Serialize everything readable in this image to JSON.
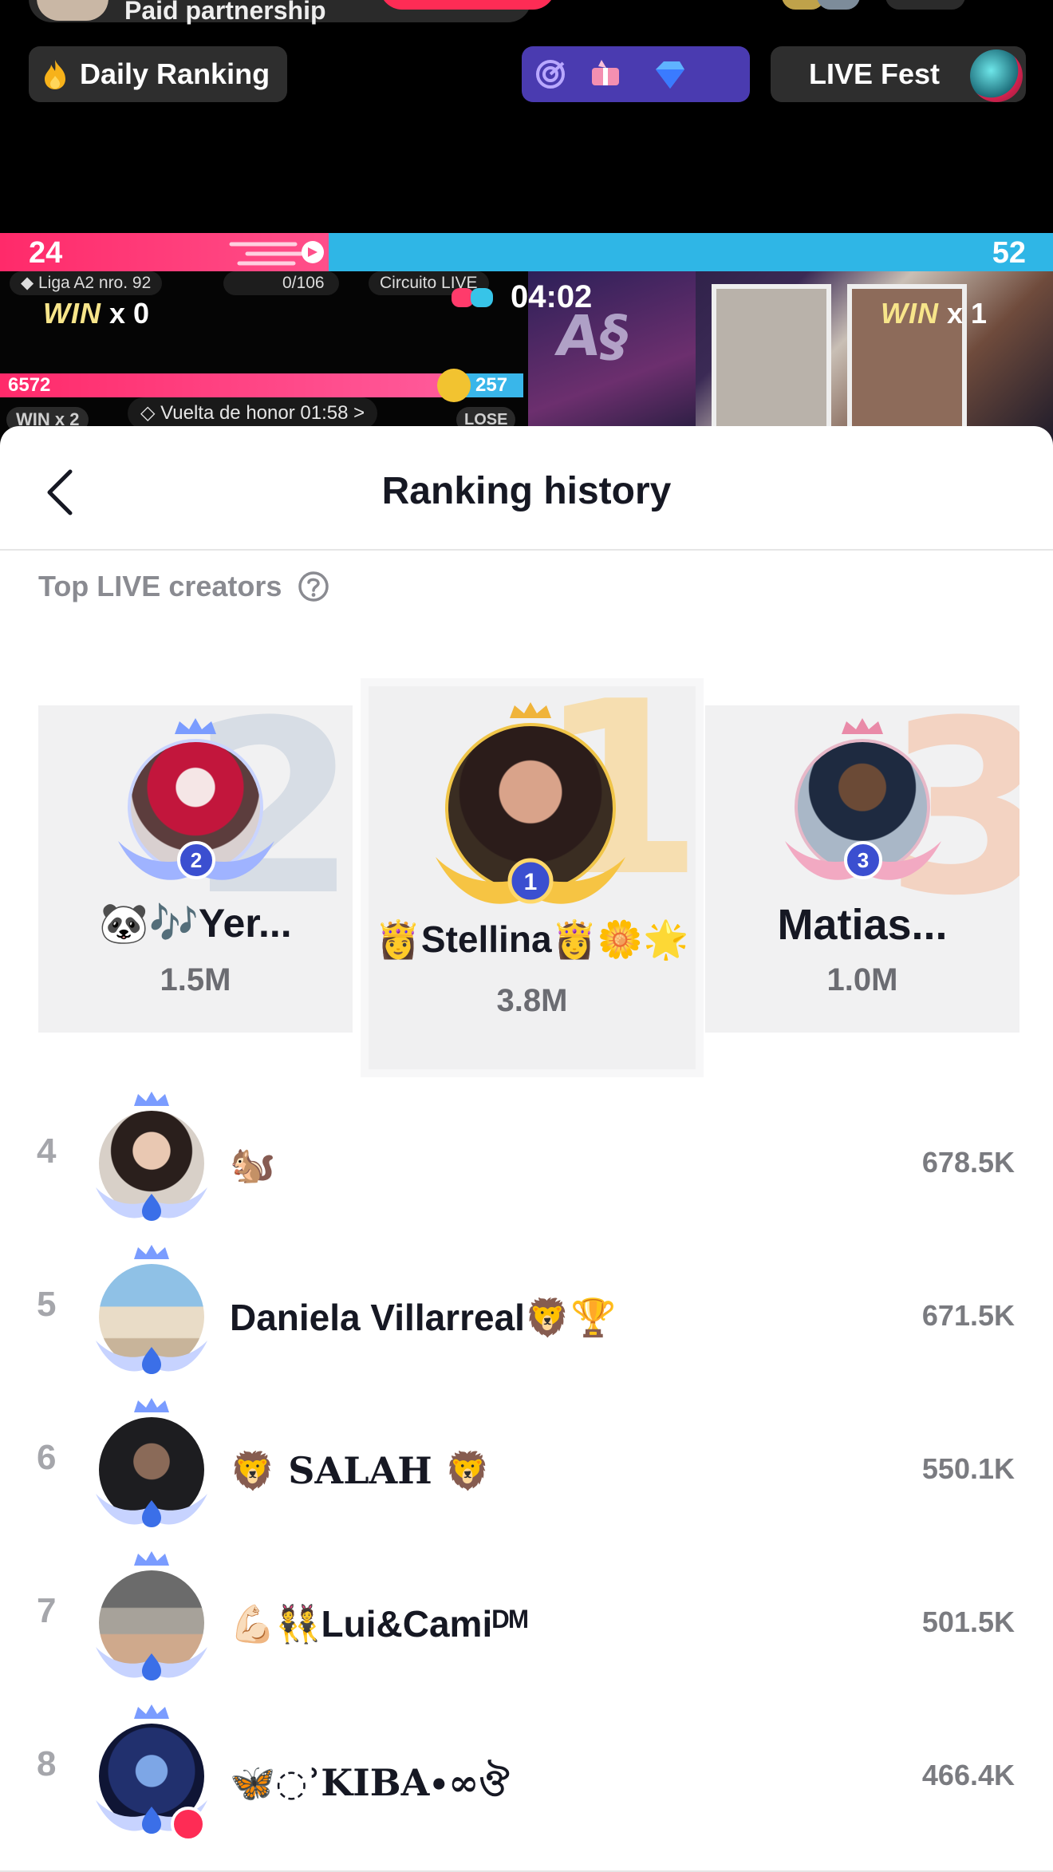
{
  "top": {
    "partnership_label": "Paid partnership",
    "daily_ranking_label": "Daily Ranking",
    "live_fest_label": "LIVE Fest",
    "battle": {
      "score_left": "24",
      "score_right": "52",
      "league_label": "Liga A2 nro. 92",
      "progress_label": "0/106",
      "circuit_label": "Circuito LIVE",
      "timer": "04:02",
      "win_word": "WIN",
      "win_left_count": "x 0",
      "win_right_count": "x 1",
      "sub_left_score": "6572",
      "sub_right_score": "257",
      "winx2_label": "WIN x 2",
      "honor_label": "Vuelta de honor  01:58  >",
      "lose_label": "LOSE"
    }
  },
  "sheet": {
    "title": "Ranking history",
    "section_label": "Top LIVE creators"
  },
  "podium": {
    "first": {
      "rank": "1",
      "name": "👸Stellina👸🌼🌟",
      "score": "3.8M"
    },
    "second": {
      "rank": "2",
      "name": "🐼🎶Yer...",
      "score": "1.5M"
    },
    "third": {
      "rank": "3",
      "name": "Matias...",
      "score": "1.0M"
    }
  },
  "ranking": [
    {
      "rank": "4",
      "name": "🐿️",
      "score": "678.5K"
    },
    {
      "rank": "5",
      "name": "Daniela Villarreal🦁🏆",
      "score": "671.5K"
    },
    {
      "rank": "6",
      "name": "🦁 SALAH 🦁",
      "score": "550.1K"
    },
    {
      "rank": "7",
      "name": "💪🏻👯Lui&Camiᴰᴹ",
      "score": "501.5K"
    },
    {
      "rank": "8",
      "name": "🦋◌ʾKIBA∙∞ঔ",
      "score": "466.4K"
    }
  ],
  "colors": {
    "accent": "#fe2c55",
    "battle_blue": "#2fb6e6",
    "text_primary": "#161823",
    "text_secondary": "#8a8b91"
  },
  "icons": {
    "back": "chevron-left-icon",
    "help": "question-circle-icon",
    "daily": "fire-icon",
    "live_fest": "live-badge-icon"
  }
}
